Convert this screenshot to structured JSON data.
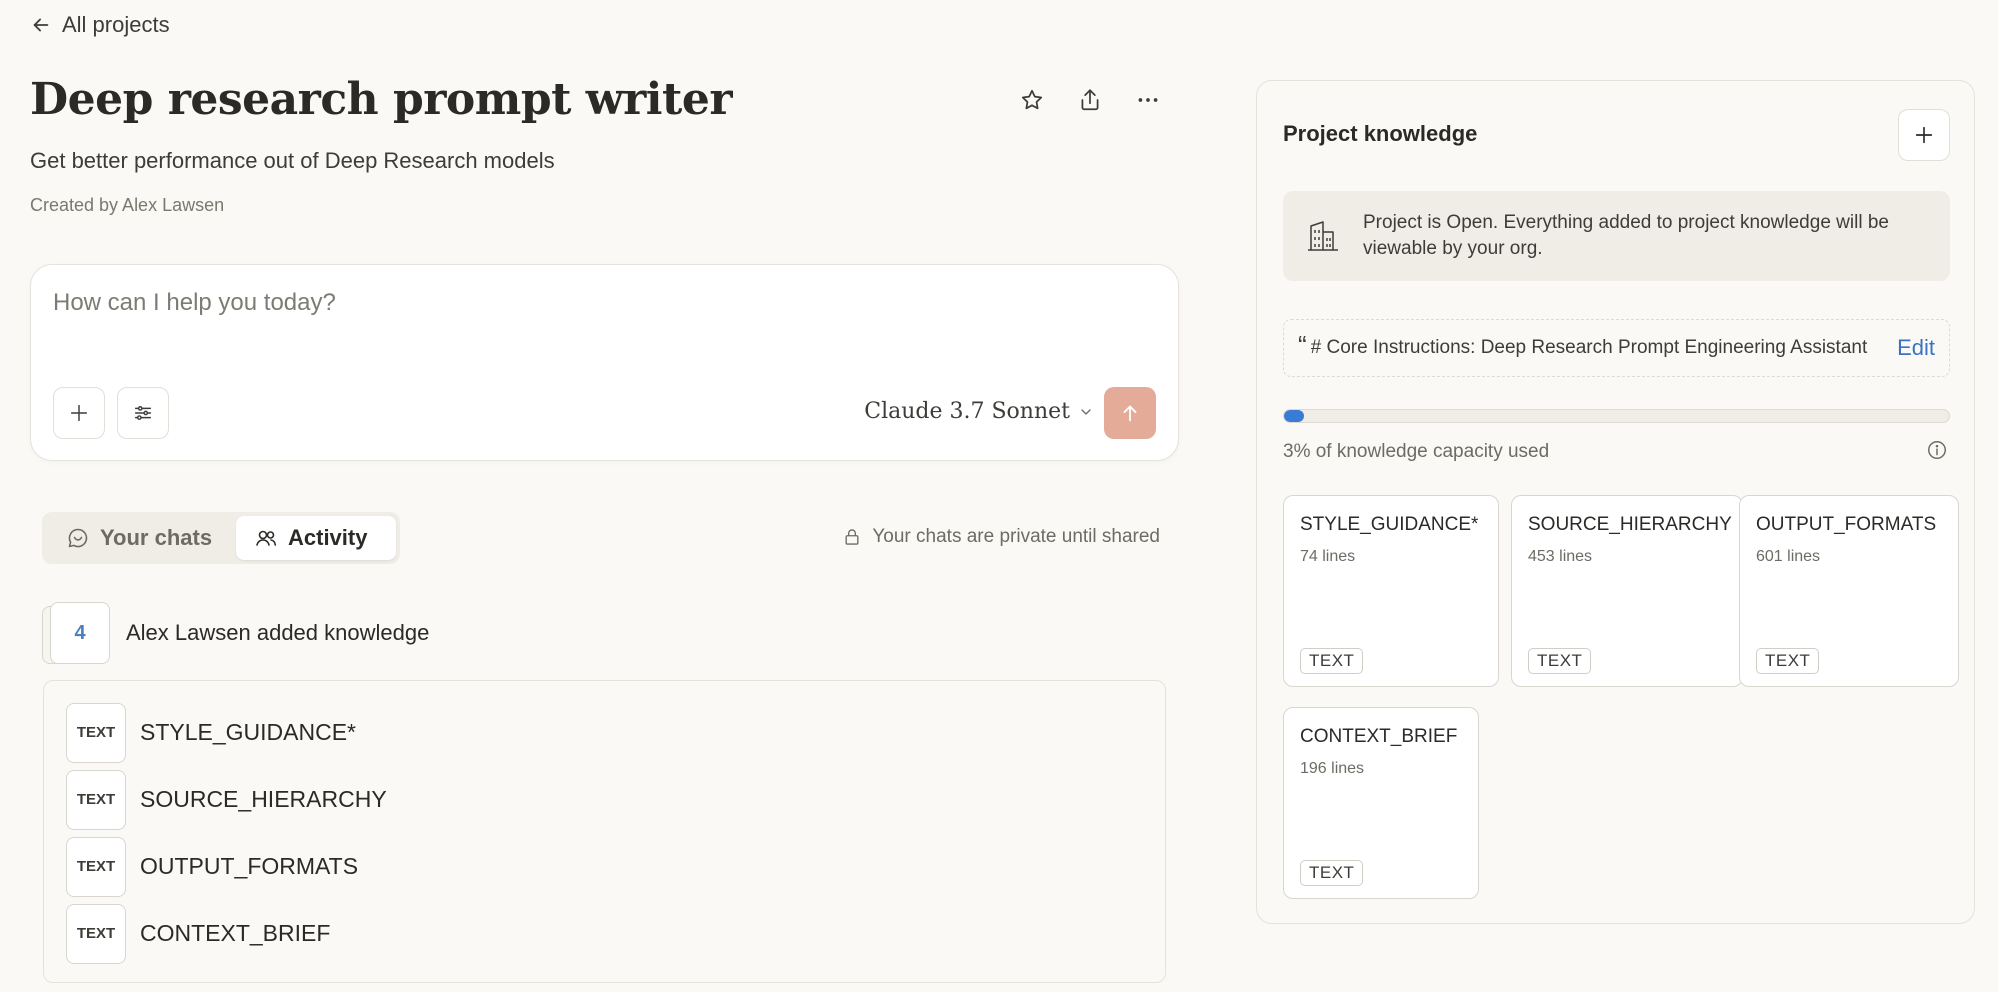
{
  "nav": {
    "back_label": "All projects"
  },
  "project": {
    "title": "Deep research prompt writer",
    "description": "Get better performance out of Deep Research models",
    "created_by": "Created by Alex Lawsen"
  },
  "composer": {
    "placeholder": "How can I help you today?",
    "model_label": "Claude 3.7 Sonnet"
  },
  "tabs": {
    "your_chats": "Your chats",
    "activity": "Activity",
    "active": "activity"
  },
  "privacy_note": "Your chats are private until shared",
  "activity": {
    "count": "4",
    "summary": "Alex Lawsen added knowledge",
    "items": [
      {
        "badge": "TEXT",
        "name": "STYLE_GUIDANCE*"
      },
      {
        "badge": "TEXT",
        "name": "SOURCE_HIERARCHY"
      },
      {
        "badge": "TEXT",
        "name": "OUTPUT_FORMATS"
      },
      {
        "badge": "TEXT",
        "name": "CONTEXT_BRIEF"
      }
    ]
  },
  "knowledge": {
    "title": "Project knowledge",
    "notice": "Project is Open. Everything added to project knowledge will be viewable by your org.",
    "instructions_preview": "# Core Instructions: Deep Research Prompt Engineering Assistant",
    "edit_label": "Edit",
    "capacity_percent": 3,
    "capacity_text": "3% of knowledge capacity used",
    "files": [
      {
        "name": "STYLE_GUIDANCE*",
        "lines": "74 lines",
        "type": "TEXT"
      },
      {
        "name": "SOURCE_HIERARCHY",
        "lines": "453 lines",
        "type": "TEXT"
      },
      {
        "name": "OUTPUT_FORMATS",
        "lines": "601 lines",
        "type": "TEXT"
      },
      {
        "name": "CONTEXT_BRIEF",
        "lines": "196 lines",
        "type": "TEXT"
      }
    ]
  },
  "colors": {
    "background": "#faf9f5",
    "accent_blue": "#3a7bd5",
    "send_button": "#e4ab99",
    "panel_notice": "#efede6"
  }
}
